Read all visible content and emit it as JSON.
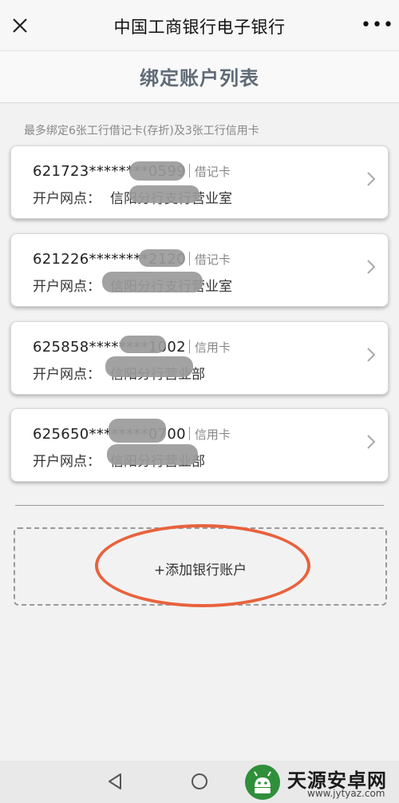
{
  "header": {
    "close_icon": "close-icon",
    "title": "中国工商银行电子银行",
    "more_icon": "more-dots-icon",
    "more_label": "•••"
  },
  "page": {
    "title": "绑定账户列表",
    "hint": "最多绑定6张工行借记卡(存折)及3张工行信用卡"
  },
  "accounts": [
    {
      "number": "621723********0599",
      "type": "借记卡",
      "branch_label": "开户网点：",
      "branch": "信阳分行支行营业室"
    },
    {
      "number": "621226********2120",
      "type": "借记卡",
      "branch_label": "开户网点：",
      "branch": "信阳分行支行营业室"
    },
    {
      "number": "625858********1002",
      "type": "信用卡",
      "branch_label": "开户网点：",
      "branch": "信阳分行营业部"
    },
    {
      "number": "625650********0700",
      "type": "信用卡",
      "branch_label": "开户网点：",
      "branch": "信阳分行营业部"
    }
  ],
  "add_account": {
    "label": "+添加银行账户"
  },
  "colors": {
    "title_color": "#5f6b76",
    "highlight": "#e8623d"
  },
  "navbar": {
    "icons": [
      "back-triangle-icon",
      "home-circle-icon"
    ]
  },
  "watermark": {
    "title": "天源安卓网",
    "url": "www.jytyaz.com"
  }
}
